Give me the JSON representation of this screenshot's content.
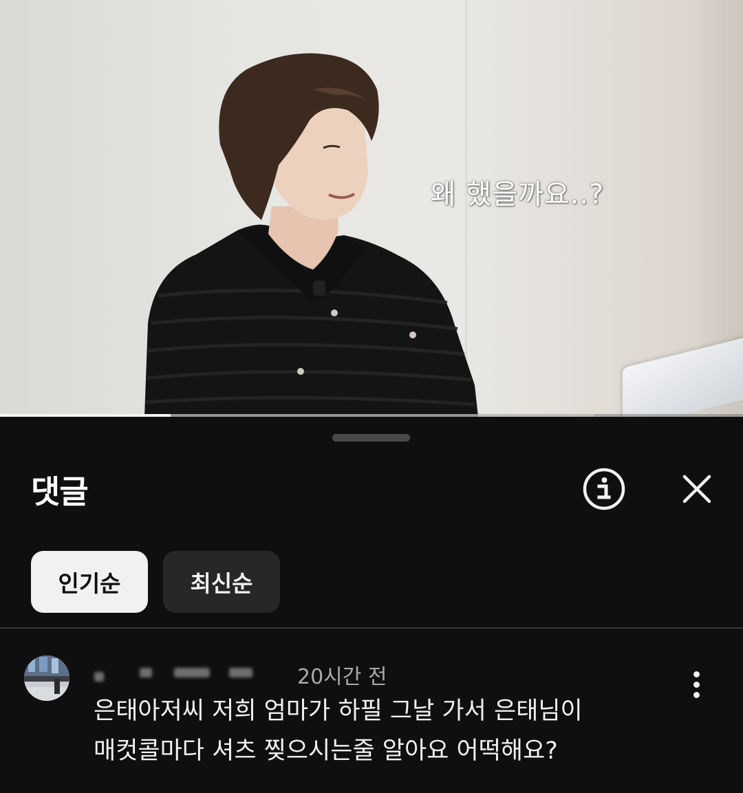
{
  "video": {
    "caption": "왜 했을까요..?",
    "progress": 0.23,
    "buffered": 0.8
  },
  "comments_panel": {
    "title": "댓글",
    "icons": {
      "info": "info-icon",
      "close": "close-icon",
      "more": "more-vert-icon"
    },
    "sort_chips": [
      {
        "label": "인기순",
        "selected": true
      },
      {
        "label": "최신순",
        "selected": false
      }
    ],
    "comments": [
      {
        "author": "",
        "timestamp": "20시간 전",
        "text_lines": [
          "은태아저씨 저희 엄마가 하필 그날 가서 은태님이",
          "매컷콜마다 셔츠 찢으시는줄 알아요 어떡해요?"
        ]
      }
    ]
  },
  "colors": {
    "background": "#0f0f0f",
    "chip_active_bg": "#f1f1f1",
    "chip_inactive_bg": "#272727",
    "secondary_text": "#aaaaaa"
  }
}
